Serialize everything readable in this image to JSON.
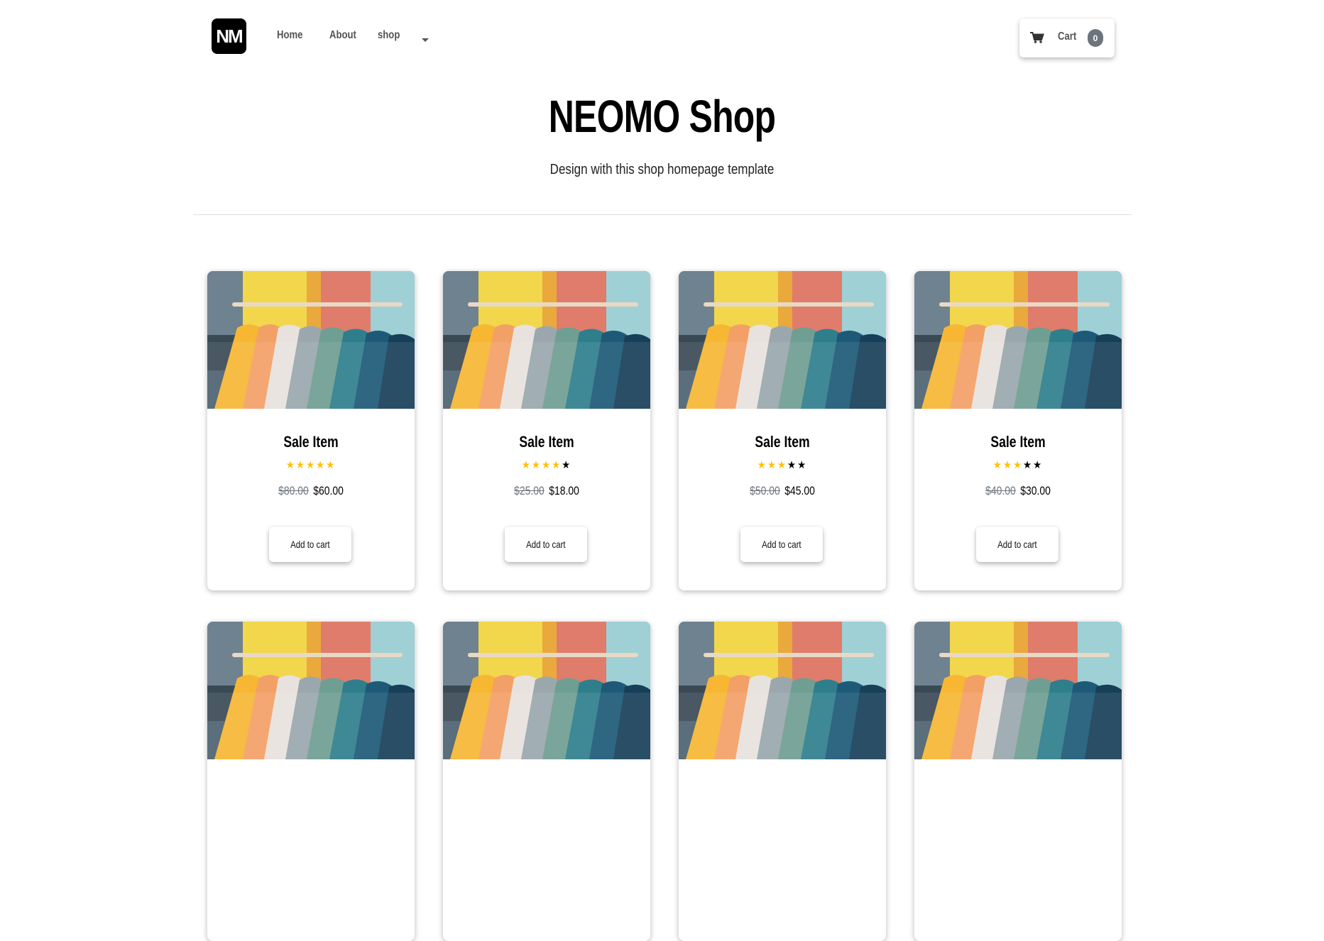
{
  "brand": {
    "logo_text": "NM"
  },
  "nav": {
    "links": [
      "Home",
      "About",
      "shop"
    ]
  },
  "cart": {
    "label": "Cart",
    "count": "0"
  },
  "header": {
    "title": "NEOMO Shop",
    "subtitle": "Design with this shop homepage template"
  },
  "colors": {
    "star_filled": "#ffc107",
    "star_empty": "#000000",
    "badge": "#6c757d"
  },
  "products": [
    {
      "title": "Sale Item",
      "rating": 5,
      "old_price": "$80.00",
      "price": "$60.00",
      "button": "Add to cart"
    },
    {
      "title": "Sale Item",
      "rating": 4,
      "old_price": "$25.00",
      "price": "$18.00",
      "button": "Add to cart"
    },
    {
      "title": "Sale Item",
      "rating": 3,
      "old_price": "$50.00",
      "price": "$45.00",
      "button": "Add to cart"
    },
    {
      "title": "Sale Item",
      "rating": 3,
      "old_price": "$40.00",
      "price": "$30.00",
      "button": "Add to cart"
    },
    {
      "title": "",
      "rating": 0,
      "old_price": "",
      "price": "",
      "button": ""
    },
    {
      "title": "",
      "rating": 0,
      "old_price": "",
      "price": "",
      "button": ""
    },
    {
      "title": "",
      "rating": 0,
      "old_price": "",
      "price": "",
      "button": ""
    },
    {
      "title": "",
      "rating": 0,
      "old_price": "",
      "price": "",
      "button": ""
    }
  ]
}
